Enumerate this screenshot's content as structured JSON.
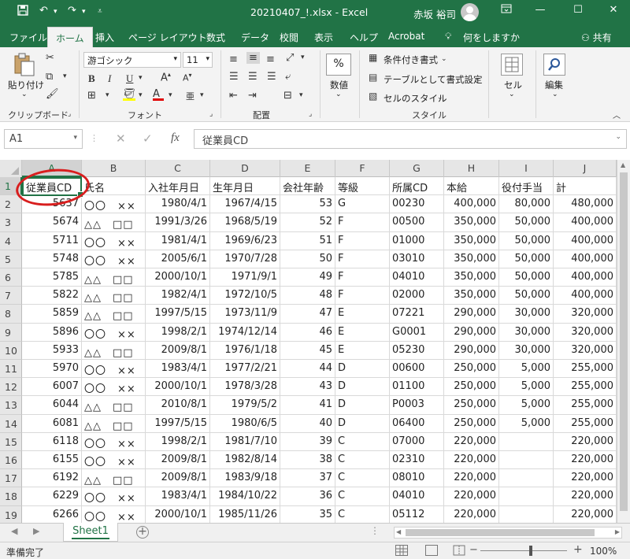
{
  "titlebar": {
    "filename": "20210407_!.xlsx",
    "app": "Excel",
    "title": "20210407_!.xlsx  -  Excel",
    "user": "赤坂 裕司"
  },
  "tabs": [
    "ファイル",
    "ホーム",
    "挿入",
    "ページ レイアウト",
    "数式",
    "データ",
    "校閲",
    "表示",
    "ヘルプ",
    "Acrobat"
  ],
  "tell_me": "何をしますか",
  "share": "共有",
  "ribbon": {
    "clipboard": {
      "paste": "貼り付け",
      "label": "クリップボード"
    },
    "font": {
      "name": "游ゴシック",
      "size": "11",
      "label": "フォント",
      "bold": "B",
      "italic": "I",
      "underline": "U"
    },
    "alignment": {
      "label": "配置"
    },
    "number": {
      "format": "数値",
      "percent": "%"
    },
    "styles": {
      "conditional": "条件付き書式",
      "table": "テーブルとして書式設定",
      "cell_style": "セルのスタイル",
      "label": "スタイル"
    },
    "cells": {
      "label": "セル"
    },
    "editing": {
      "label": "編集"
    }
  },
  "formula_bar": {
    "name_box": "A1",
    "fx": "fx",
    "content": "従業員CD"
  },
  "columns": [
    "A",
    "B",
    "C",
    "D",
    "E",
    "F",
    "G",
    "H",
    "I",
    "J"
  ],
  "rows": [
    {
      "n": "1",
      "cells": [
        "従業員CD",
        "氏名",
        "入社年月日",
        "生年月日",
        "会社年齢",
        "等級",
        "所属CD",
        "本給",
        "役付手当",
        "計"
      ]
    },
    {
      "n": "2",
      "cells": [
        "5637",
        "〇〇　××",
        "1980/4/1",
        "1967/4/15",
        "53",
        "G",
        "00230",
        "400,000",
        "80,000",
        "480,000"
      ]
    },
    {
      "n": "3",
      "cells": [
        "5674",
        "△△　□□",
        "1991/3/26",
        "1968/5/19",
        "52",
        "F",
        "00500",
        "350,000",
        "50,000",
        "400,000"
      ]
    },
    {
      "n": "4",
      "cells": [
        "5711",
        "〇〇　××",
        "1981/4/1",
        "1969/6/23",
        "51",
        "F",
        "01000",
        "350,000",
        "50,000",
        "400,000"
      ]
    },
    {
      "n": "5",
      "cells": [
        "5748",
        "〇〇　××",
        "2005/6/1",
        "1970/7/28",
        "50",
        "F",
        "03010",
        "350,000",
        "50,000",
        "400,000"
      ]
    },
    {
      "n": "6",
      "cells": [
        "5785",
        "△△　□□",
        "2000/10/1",
        "1971/9/1",
        "49",
        "F",
        "04010",
        "350,000",
        "50,000",
        "400,000"
      ]
    },
    {
      "n": "7",
      "cells": [
        "5822",
        "△△　□□",
        "1982/4/1",
        "1972/10/5",
        "48",
        "F",
        "02000",
        "350,000",
        "50,000",
        "400,000"
      ]
    },
    {
      "n": "8",
      "cells": [
        "5859",
        "△△　□□",
        "1997/5/15",
        "1973/11/9",
        "47",
        "E",
        "07221",
        "290,000",
        "30,000",
        "320,000"
      ]
    },
    {
      "n": "9",
      "cells": [
        "5896",
        "〇〇　××",
        "1998/2/1",
        "1974/12/14",
        "46",
        "E",
        "G0001",
        "290,000",
        "30,000",
        "320,000"
      ]
    },
    {
      "n": "10",
      "cells": [
        "5933",
        "△△　□□",
        "2009/8/1",
        "1976/1/18",
        "45",
        "E",
        "05230",
        "290,000",
        "30,000",
        "320,000"
      ]
    },
    {
      "n": "11",
      "cells": [
        "5970",
        "〇〇　××",
        "1983/4/1",
        "1977/2/21",
        "44",
        "D",
        "00600",
        "250,000",
        "5,000",
        "255,000"
      ]
    },
    {
      "n": "12",
      "cells": [
        "6007",
        "〇〇　××",
        "2000/10/1",
        "1978/3/28",
        "43",
        "D",
        "01100",
        "250,000",
        "5,000",
        "255,000"
      ]
    },
    {
      "n": "13",
      "cells": [
        "6044",
        "△△　□□",
        "2010/8/1",
        "1979/5/2",
        "41",
        "D",
        "P0003",
        "250,000",
        "5,000",
        "255,000"
      ]
    },
    {
      "n": "14",
      "cells": [
        "6081",
        "△△　□□",
        "1997/5/15",
        "1980/6/5",
        "40",
        "D",
        "06400",
        "250,000",
        "5,000",
        "255,000"
      ]
    },
    {
      "n": "15",
      "cells": [
        "6118",
        "〇〇　××",
        "1998/2/1",
        "1981/7/10",
        "39",
        "C",
        "07000",
        "220,000",
        "",
        "220,000"
      ]
    },
    {
      "n": "16",
      "cells": [
        "6155",
        "〇〇　××",
        "2009/8/1",
        "1982/8/14",
        "38",
        "C",
        "02310",
        "220,000",
        "",
        "220,000"
      ]
    },
    {
      "n": "17",
      "cells": [
        "6192",
        "△△　□□",
        "2009/8/1",
        "1983/9/18",
        "37",
        "C",
        "08010",
        "220,000",
        "",
        "220,000"
      ]
    },
    {
      "n": "18",
      "cells": [
        "6229",
        "〇〇　××",
        "1983/4/1",
        "1984/10/22",
        "36",
        "C",
        "04010",
        "220,000",
        "",
        "220,000"
      ]
    },
    {
      "n": "19",
      "cells": [
        "6266",
        "〇〇　××",
        "2000/10/1",
        "1985/11/26",
        "35",
        "C",
        "05112",
        "220,000",
        "",
        "220,000"
      ]
    }
  ],
  "sheet_tab": "Sheet1",
  "status": "準備完了",
  "zoom": "100%",
  "colors": {
    "accent": "#217346",
    "annotation": "#d81e1e"
  }
}
